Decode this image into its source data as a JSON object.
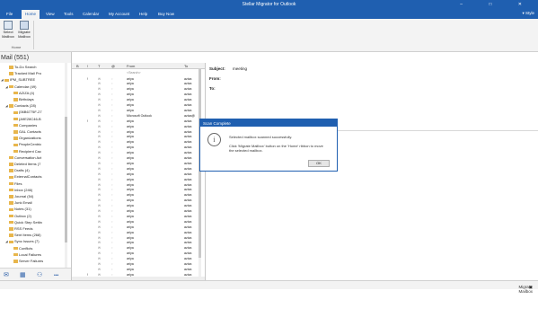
{
  "window": {
    "title": "Stellar Migrator for Outlook",
    "controls": [
      "–",
      "□",
      "✕"
    ]
  },
  "ribbon": {
    "tabs": [
      "File",
      "Home",
      "View",
      "Tools",
      "Calendar",
      "My Account",
      "Help",
      "Buy Now"
    ],
    "active_tab": "Home",
    "style_label": "Style",
    "buttons": [
      {
        "label": "Select Mailbox",
        "icon": "mailbox-icon"
      },
      {
        "label": "Migrate Mailbox",
        "icon": "save-icon"
      }
    ],
    "group_label": "Home"
  },
  "folder_pane": {
    "header": "Mail (551)",
    "tree": [
      {
        "indent": 2,
        "label": "To-Do Search"
      },
      {
        "indent": 2,
        "label": "Tracked Mail Pro"
      },
      {
        "indent": 1,
        "label": "IPM_SUBTREE",
        "arrow": "◢"
      },
      {
        "indent": 2,
        "label": "Calendar (49)",
        "arrow": "◢"
      },
      {
        "indent": 3,
        "label": "AZIZA (4)"
      },
      {
        "indent": 3,
        "label": "Birthdays"
      },
      {
        "indent": 2,
        "label": "Contacts (28)",
        "arrow": "◢"
      },
      {
        "indent": 3,
        "label": "{06B6775F-27"
      },
      {
        "indent": 3,
        "label": "{A9E28C46-B"
      },
      {
        "indent": 3,
        "label": "Companies"
      },
      {
        "indent": 3,
        "label": "GAL Contacts"
      },
      {
        "indent": 3,
        "label": "Organizations"
      },
      {
        "indent": 3,
        "label": "PeopleCentric"
      },
      {
        "indent": 3,
        "label": "Recipient Cac"
      },
      {
        "indent": 2,
        "label": "Conversation Act"
      },
      {
        "indent": 2,
        "label": "Deleted Items (7"
      },
      {
        "indent": 2,
        "label": "Drafts (4)"
      },
      {
        "indent": 2,
        "label": "ExternalContacts"
      },
      {
        "indent": 2,
        "label": "Files"
      },
      {
        "indent": 2,
        "label": "Inbox (246)"
      },
      {
        "indent": 2,
        "label": "Journal (54)"
      },
      {
        "indent": 2,
        "label": "Junk Email"
      },
      {
        "indent": 2,
        "label": "Notes (31)"
      },
      {
        "indent": 2,
        "label": "Outbox (2)"
      },
      {
        "indent": 2,
        "label": "Quick Step Settin"
      },
      {
        "indent": 2,
        "label": "RSS Feeds"
      },
      {
        "indent": 2,
        "label": "Sent Items (268)"
      },
      {
        "indent": 2,
        "label": "Sync Issues (7)",
        "arrow": "◢"
      },
      {
        "indent": 3,
        "label": "Conflicts"
      },
      {
        "indent": 3,
        "label": "Local Failures"
      },
      {
        "indent": 3,
        "label": "Server Failures"
      }
    ]
  },
  "nav": {
    "icons": [
      "mail-icon",
      "calendar-icon",
      "contacts-icon",
      "more-icon"
    ],
    "glyphs": [
      "✉",
      "▦",
      "⚇",
      "•••"
    ]
  },
  "message_list": {
    "columns": [
      "",
      "!",
      "",
      "📎",
      "From",
      "To"
    ],
    "col_labels": {
      "c0": "B",
      "c1": "!",
      "c2": "T",
      "c3": "@",
      "c4": "From",
      "c5": "To"
    },
    "search_placeholder": "<Search>",
    "rows": [
      {
        "imp": "!",
        "from": "ariya",
        "to": "aziza"
      },
      {
        "imp": "",
        "from": "ariya",
        "to": "aziza"
      },
      {
        "imp": "",
        "from": "ariya",
        "to": "aziza"
      },
      {
        "imp": "",
        "from": "ariya",
        "to": "aziza"
      },
      {
        "imp": "",
        "from": "ariya",
        "to": "aziza"
      },
      {
        "imp": "",
        "from": "ariya",
        "to": "aziza"
      },
      {
        "imp": "",
        "from": "ariya",
        "to": "aziza"
      },
      {
        "imp": "",
        "from": "Microsoft Outlook",
        "to": "aziza@"
      },
      {
        "imp": "!",
        "from": "ariya",
        "to": "aziza"
      },
      {
        "imp": "",
        "from": "ariya",
        "to": "aziza"
      },
      {
        "imp": "",
        "from": "ariya",
        "to": "aziza"
      },
      {
        "imp": "",
        "from": "ariya",
        "to": "aziza"
      },
      {
        "imp": "",
        "from": "ariya",
        "to": "aziza"
      },
      {
        "imp": "",
        "from": "ariya",
        "to": "aziza"
      },
      {
        "imp": "",
        "from": "ariya",
        "to": "aziza"
      },
      {
        "imp": "",
        "from": "ariya",
        "to": "aziza"
      },
      {
        "imp": "",
        "from": "ariya",
        "to": "aziza"
      },
      {
        "imp": "",
        "from": "ariya",
        "to": "aziza"
      },
      {
        "imp": "",
        "from": "ariya",
        "to": "aziza"
      },
      {
        "imp": "",
        "from": "ariya",
        "to": "aziza"
      },
      {
        "imp": "",
        "from": "ariya",
        "to": "aziza"
      },
      {
        "imp": "",
        "from": "ariya",
        "to": "aziza"
      },
      {
        "imp": "",
        "from": "ariya",
        "to": "aziza"
      },
      {
        "imp": "",
        "from": "ariya",
        "to": "aziza"
      },
      {
        "imp": "",
        "from": "ariya",
        "to": "aziza"
      },
      {
        "imp": "",
        "from": "ariya",
        "to": "aziza"
      },
      {
        "imp": "",
        "from": "ariya",
        "to": "aziza"
      },
      {
        "imp": "",
        "from": "ariya",
        "to": "aziza"
      },
      {
        "imp": "",
        "from": "ariya",
        "to": "aziza"
      },
      {
        "imp": "",
        "from": "ariya",
        "to": "aziza"
      },
      {
        "imp": "",
        "from": "ariya",
        "to": "aziza"
      },
      {
        "imp": "",
        "from": "ariya",
        "to": "aziza"
      },
      {
        "imp": "",
        "from": "ariya",
        "to": "aziza"
      },
      {
        "imp": "",
        "from": "ariya",
        "to": "aziza"
      },
      {
        "imp": "",
        "from": "ariya",
        "to": "aziza"
      },
      {
        "imp": "",
        "from": "ariya",
        "to": "aziza"
      },
      {
        "imp": "",
        "from": "ariya",
        "to": "aziza"
      },
      {
        "imp": "!",
        "from": "ariya",
        "to": "aziza"
      }
    ]
  },
  "preview": {
    "subject_label": "Subject:",
    "subject_value": "meeting",
    "from_label": "From:",
    "to_label": "To:"
  },
  "dialog": {
    "title": "Scan Complete",
    "icon": "info-icon",
    "line1": "Selected mailbox scanned successfully.",
    "line2": "Click 'Migrate Mailbox' button on the 'Home' ribbon to move",
    "line3": "the selected mailbox.",
    "ok_label": "OK"
  },
  "status": {
    "text": "Migrate Mailbox"
  },
  "colors": {
    "accent": "#1f5fb0",
    "folder": "#e8b64c"
  }
}
